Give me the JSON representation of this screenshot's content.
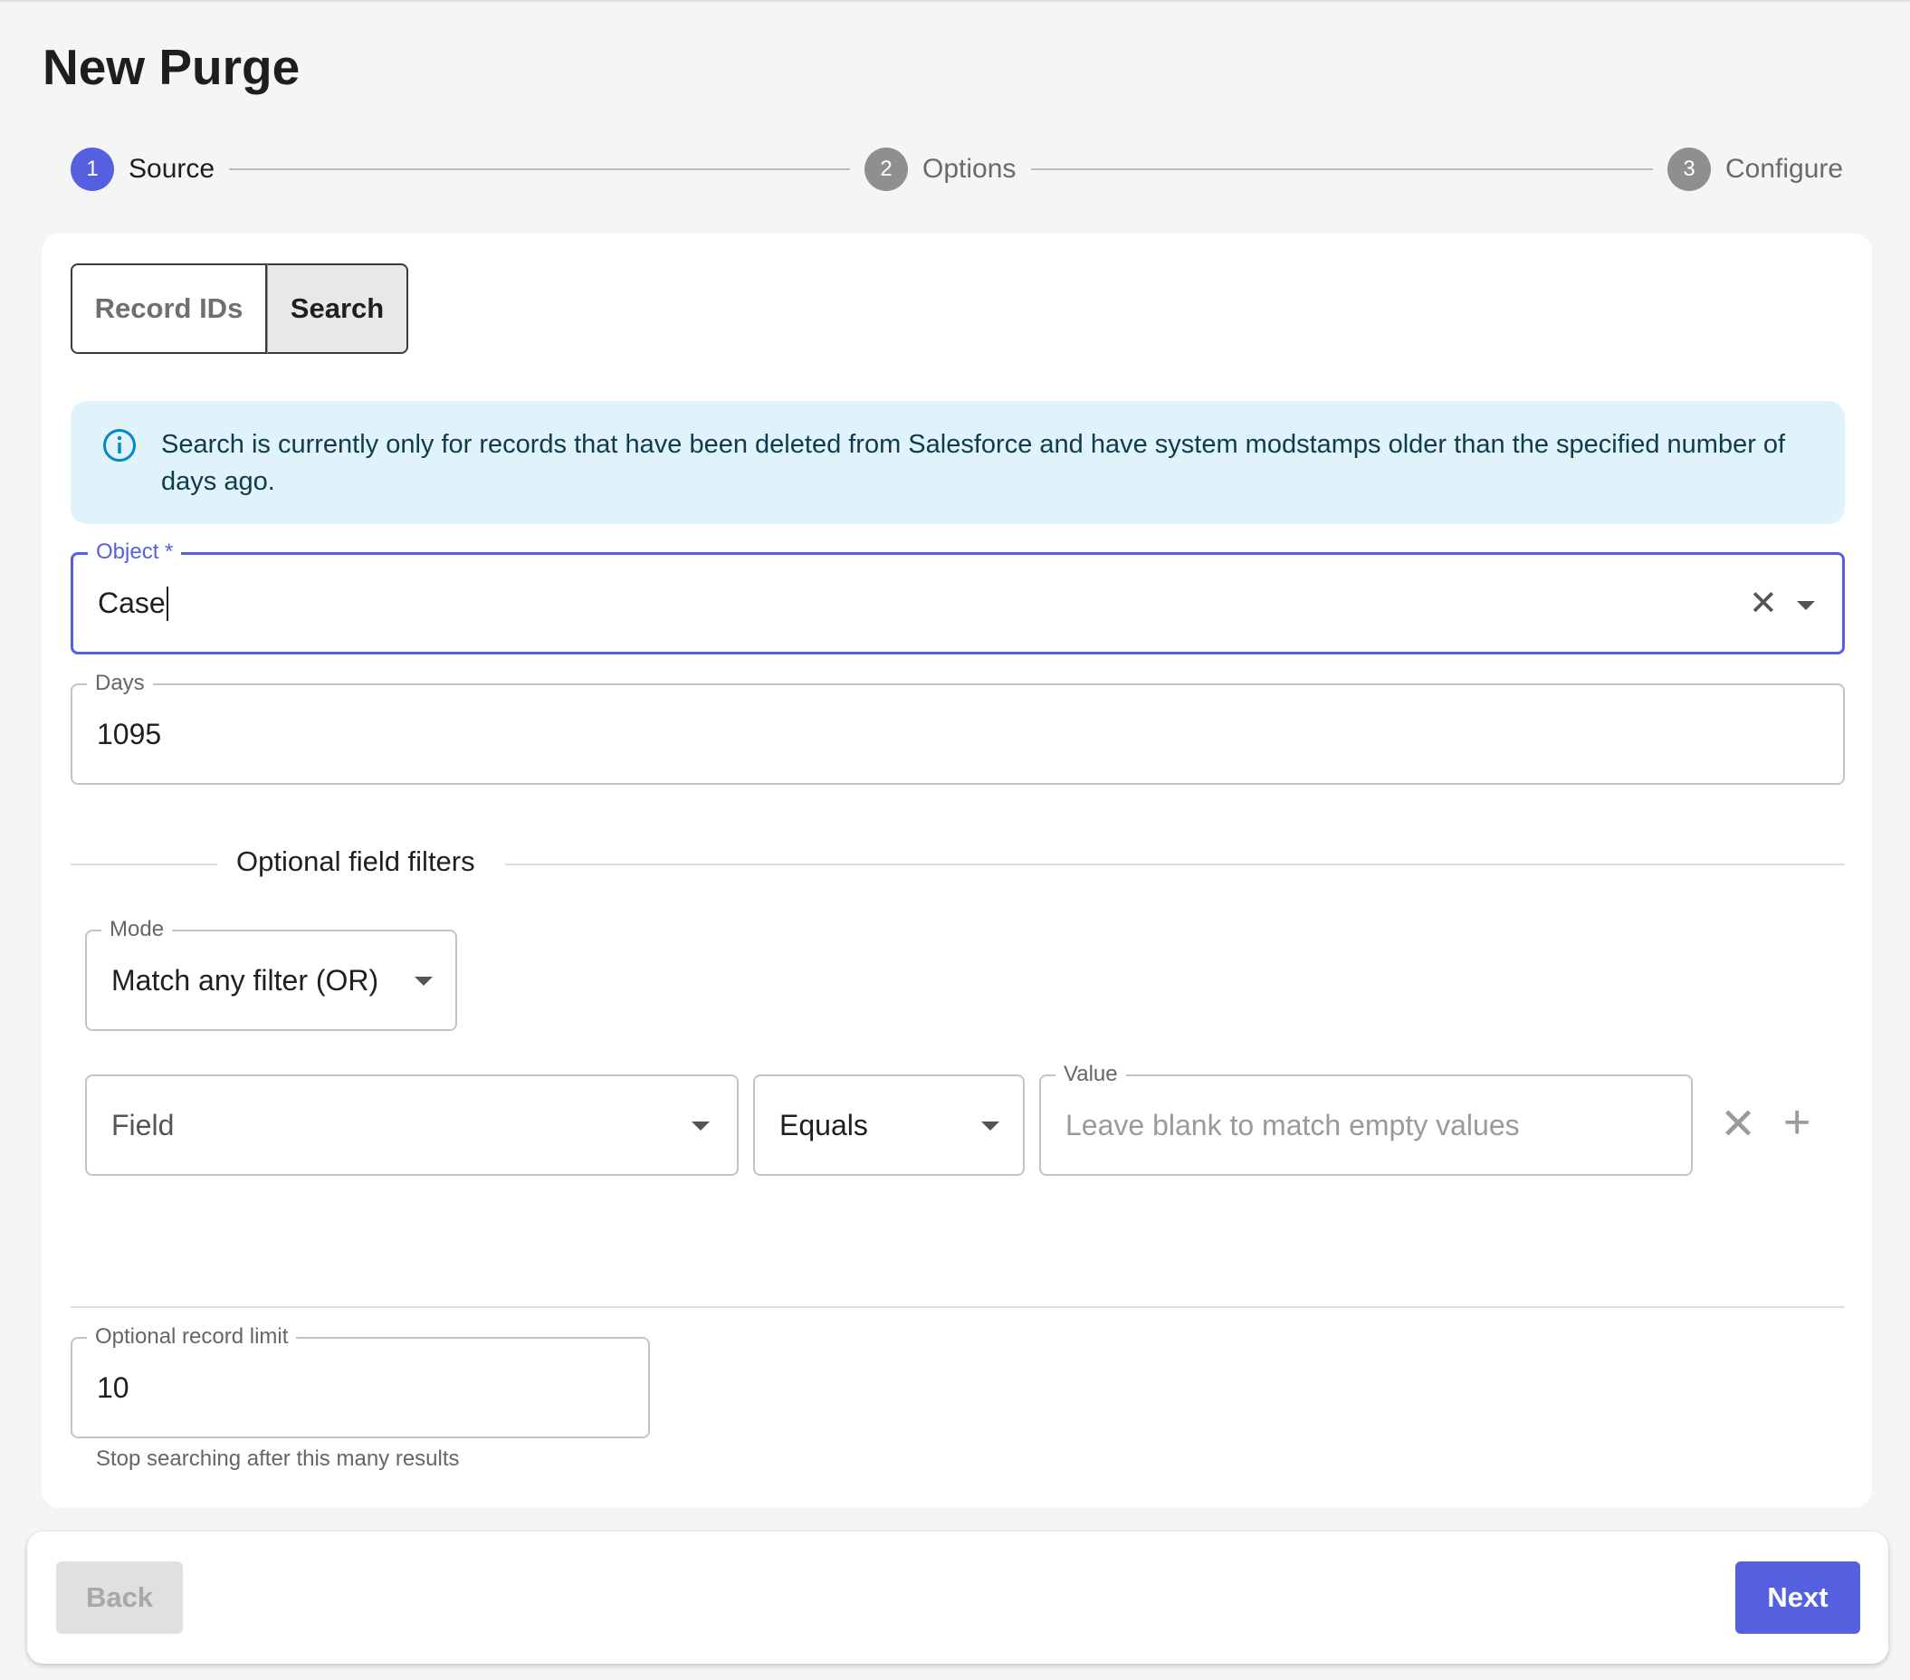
{
  "page": {
    "title": "New Purge"
  },
  "stepper": {
    "steps": [
      {
        "number": "1",
        "label": "Source",
        "state": "active"
      },
      {
        "number": "2",
        "label": "Options",
        "state": "inactive"
      },
      {
        "number": "3",
        "label": "Configure",
        "state": "inactive"
      }
    ]
  },
  "source_mode": {
    "options": [
      "Record IDs",
      "Search"
    ],
    "selected": "Search"
  },
  "info_alert": {
    "icon": "info-icon",
    "text": "Search is currently only for records that have been deleted from Salesforce and have system modstamps older than the specified number of days ago."
  },
  "object_field": {
    "label": "Object *",
    "value": "Case"
  },
  "days_field": {
    "label": "Days",
    "value": "1095"
  },
  "filters": {
    "section_label": "Optional field filters",
    "mode": {
      "label": "Mode",
      "value": "Match any filter (OR)"
    },
    "row": {
      "field_placeholder": "Field",
      "operator_value": "Equals",
      "value_label": "Value",
      "value_placeholder": "Leave blank to match empty values"
    }
  },
  "record_limit": {
    "label": "Optional record limit",
    "value": "10",
    "helper": "Stop searching after this many results"
  },
  "footer": {
    "back_label": "Back",
    "next_label": "Next"
  },
  "colors": {
    "accent": "#5460e0",
    "alert_bg": "#e0f3fa",
    "page_bg": "#f5f5f5"
  }
}
